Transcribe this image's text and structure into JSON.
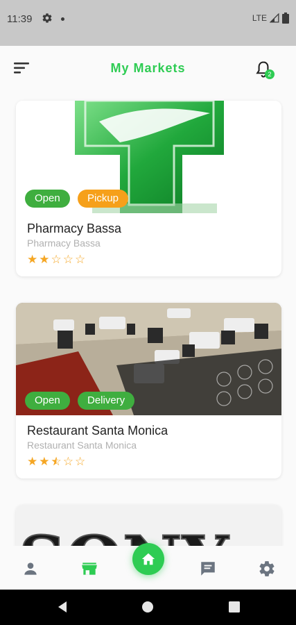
{
  "status_bar": {
    "time": "11:39",
    "network": "LTE",
    "icons": [
      "gear-icon",
      "dot-icon",
      "signal-icon",
      "battery-icon"
    ]
  },
  "app_bar": {
    "title": "My Markets",
    "menu_icon": "menu-icon",
    "notification_icon": "bell-icon",
    "notification_count": "2"
  },
  "colors": {
    "accent": "#2ecc53",
    "open_badge": "#3fae3f",
    "pickup_badge": "#f6a01a",
    "star": "#f5a623",
    "subtitle": "#b0b0b0"
  },
  "markets": [
    {
      "name": "Pharmacy Bassa",
      "subtitle": "Pharmacy Bassa",
      "badges": [
        "Open",
        "Pickup"
      ],
      "rating": 2
    },
    {
      "name": "Restaurant Santa Monica",
      "subtitle": "Restaurant Santa Monica",
      "badges": [
        "Open",
        "Delivery"
      ],
      "rating": 2.5
    },
    {
      "image_text": "SONY"
    }
  ],
  "bottom_nav": {
    "items": [
      "person-icon",
      "store-icon",
      "home-icon",
      "chat-icon",
      "settings-icon"
    ],
    "active": "store-icon"
  },
  "system_nav": [
    "back-icon",
    "home-circle-icon",
    "recents-icon"
  ]
}
